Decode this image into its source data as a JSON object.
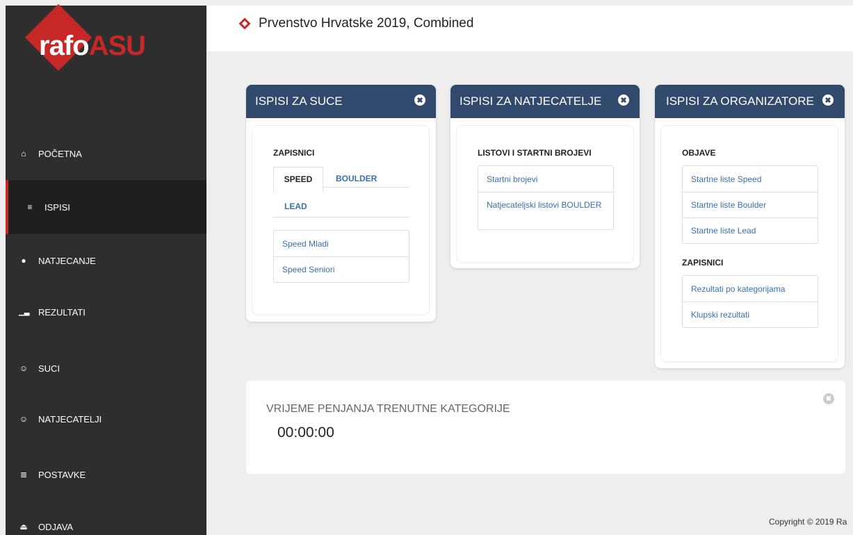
{
  "logo": {
    "part1": "rafo",
    "part2": "ASU"
  },
  "header": {
    "title": "Prvenstvo Hrvatske 2019, Combined"
  },
  "sidebar": {
    "items": [
      {
        "label": "POČETNA",
        "icon": "home-icon"
      },
      {
        "label": "ISPISI",
        "icon": "database-icon"
      },
      {
        "label": "NATJECANJE",
        "icon": "exclamation-icon"
      },
      {
        "label": "REZULTATI",
        "icon": "bar-chart-icon"
      },
      {
        "label": "SUCI",
        "icon": "users-icon"
      },
      {
        "label": "NATJECATELJI",
        "icon": "users-icon"
      },
      {
        "label": "POSTAVKE",
        "icon": "sliders-icon"
      },
      {
        "label": "ODJAVA",
        "icon": "eject-icon"
      }
    ]
  },
  "panels": {
    "suce": {
      "title": "ISPISI ZA SUCE",
      "section": "ZAPISNICI",
      "tabs": [
        "SPEED",
        "BOULDER",
        "LEAD"
      ],
      "items": [
        "Speed Mladi",
        "Speed Seniori"
      ]
    },
    "natjecatelje": {
      "title": "ISPISI ZA NATJECATELJE",
      "section": "LISTOVI I STARTNI BROJEVI",
      "items": [
        "Startni brojevi",
        "Natjecateljski listovi BOULDER"
      ]
    },
    "organizatore": {
      "title": "ISPISI ZA ORGANIZATORE",
      "section1": "OBJAVE",
      "items1": [
        "Startne liste Speed",
        "Startne liste Boulder",
        "Startne liste Lead"
      ],
      "section2": "ZAPISNICI",
      "items2": [
        "Rezultati po kategorijama",
        "Klupski rezultati"
      ]
    }
  },
  "timer": {
    "label": "VRIJEME PENJANJA TRENUTNE KATEGORIJE",
    "value": "00:00:00"
  },
  "footer": {
    "text": "Copyright © 2019 Ra"
  },
  "colors": {
    "sidebar": "#2e2e2e",
    "accent": "#c62828",
    "panel_header": "#31496c",
    "link": "#3a6fae"
  }
}
